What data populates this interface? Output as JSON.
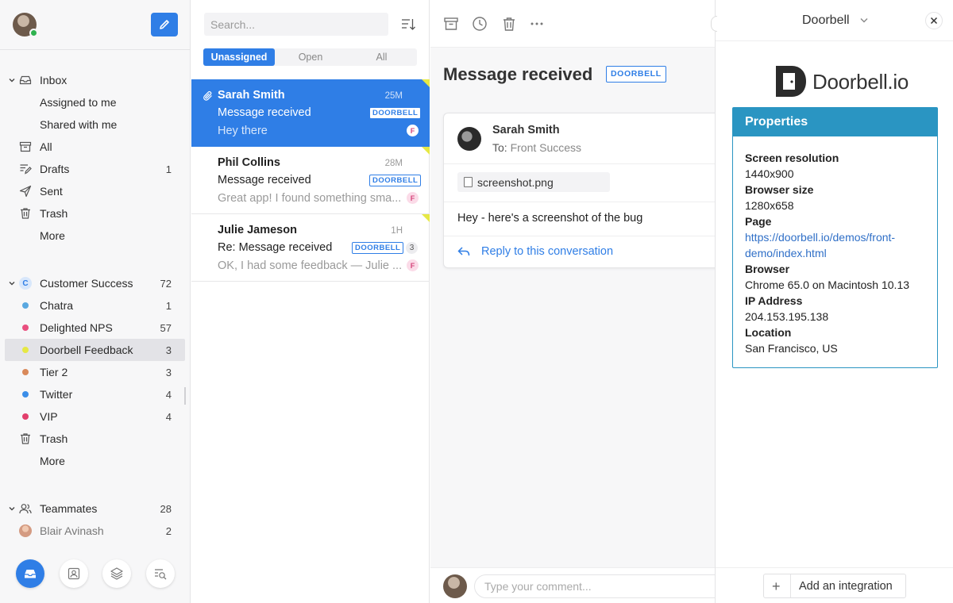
{
  "sidebar": {
    "inbox": {
      "label": "Inbox"
    },
    "items": [
      {
        "label": "Assigned to me",
        "count": ""
      },
      {
        "label": "Shared with me",
        "count": ""
      },
      {
        "label": "All",
        "count": ""
      },
      {
        "label": "Drafts",
        "count": "1"
      },
      {
        "label": "Sent",
        "count": ""
      },
      {
        "label": "Trash",
        "count": ""
      },
      {
        "label": "More",
        "count": ""
      }
    ],
    "team": {
      "label": "Customer Success",
      "badge": "C",
      "count": "72"
    },
    "team_items": [
      {
        "label": "Chatra",
        "count": "1",
        "color": "#5aa8e0"
      },
      {
        "label": "Delighted NPS",
        "count": "57",
        "color": "#e94f7f"
      },
      {
        "label": "Doorbell Feedback",
        "count": "3",
        "color": "#e6e844"
      },
      {
        "label": "Tier 2",
        "count": "3",
        "color": "#d9895a"
      },
      {
        "label": "Twitter",
        "count": "4",
        "color": "#3b8ee8"
      },
      {
        "label": "VIP",
        "count": "4",
        "color": "#e23f6c"
      },
      {
        "label": "Trash",
        "count": ""
      },
      {
        "label": "More",
        "count": ""
      }
    ],
    "teammates": {
      "label": "Teammates",
      "count": "28"
    },
    "teammate_items": [
      {
        "label": "Blair Avinash",
        "count": "2"
      }
    ]
  },
  "list": {
    "search_placeholder": "Search...",
    "filters": [
      "Unassigned",
      "Open",
      "All"
    ],
    "messages": [
      {
        "from": "Sarah Smith",
        "time": "25M",
        "subject": "Message received",
        "tag": "DOORBELL",
        "preview": "Hey there",
        "badge": "F"
      },
      {
        "from": "Phil Collins",
        "time": "28M",
        "subject": "Message received",
        "tag": "DOORBELL",
        "preview": "Great app! I found something sma...",
        "badge": "F"
      },
      {
        "from": "Julie Jameson",
        "time": "1H",
        "subject": "Re: Message received",
        "tag": "DOORBELL",
        "count": "3",
        "preview": "OK, I had some feedback — Julie ...",
        "badge": "F"
      }
    ]
  },
  "conversation": {
    "title": "Message received",
    "tag": "DOORBELL",
    "sender": "Sarah Smith",
    "to_label": "To:",
    "to_value": "Front Success",
    "attachment": "screenshot.png",
    "body": "Hey - here's a screenshot of the bug",
    "reply": "Reply to this conversation",
    "comment_placeholder": "Type your comment..."
  },
  "panel": {
    "title": "Doorbell",
    "brand": "Doorbell.io",
    "properties_title": "Properties",
    "properties": [
      {
        "key": "Screen resolution",
        "value": "1440x900"
      },
      {
        "key": "Browser size",
        "value": "1280x658"
      },
      {
        "key": "Page",
        "value": "https://doorbell.io/demos/front-demo/index.html",
        "link": true
      },
      {
        "key": "Browser",
        "value": "Chrome 65.0 on Macintosh 10.13"
      },
      {
        "key": "IP Address",
        "value": "204.153.195.138"
      },
      {
        "key": "Location",
        "value": "San Francisco, US"
      }
    ],
    "add_integration": "Add an integration"
  },
  "colors": {
    "accent": "#2f7ee6",
    "properties_header": "#2a95c2",
    "tag_corner": "#e6e844"
  }
}
